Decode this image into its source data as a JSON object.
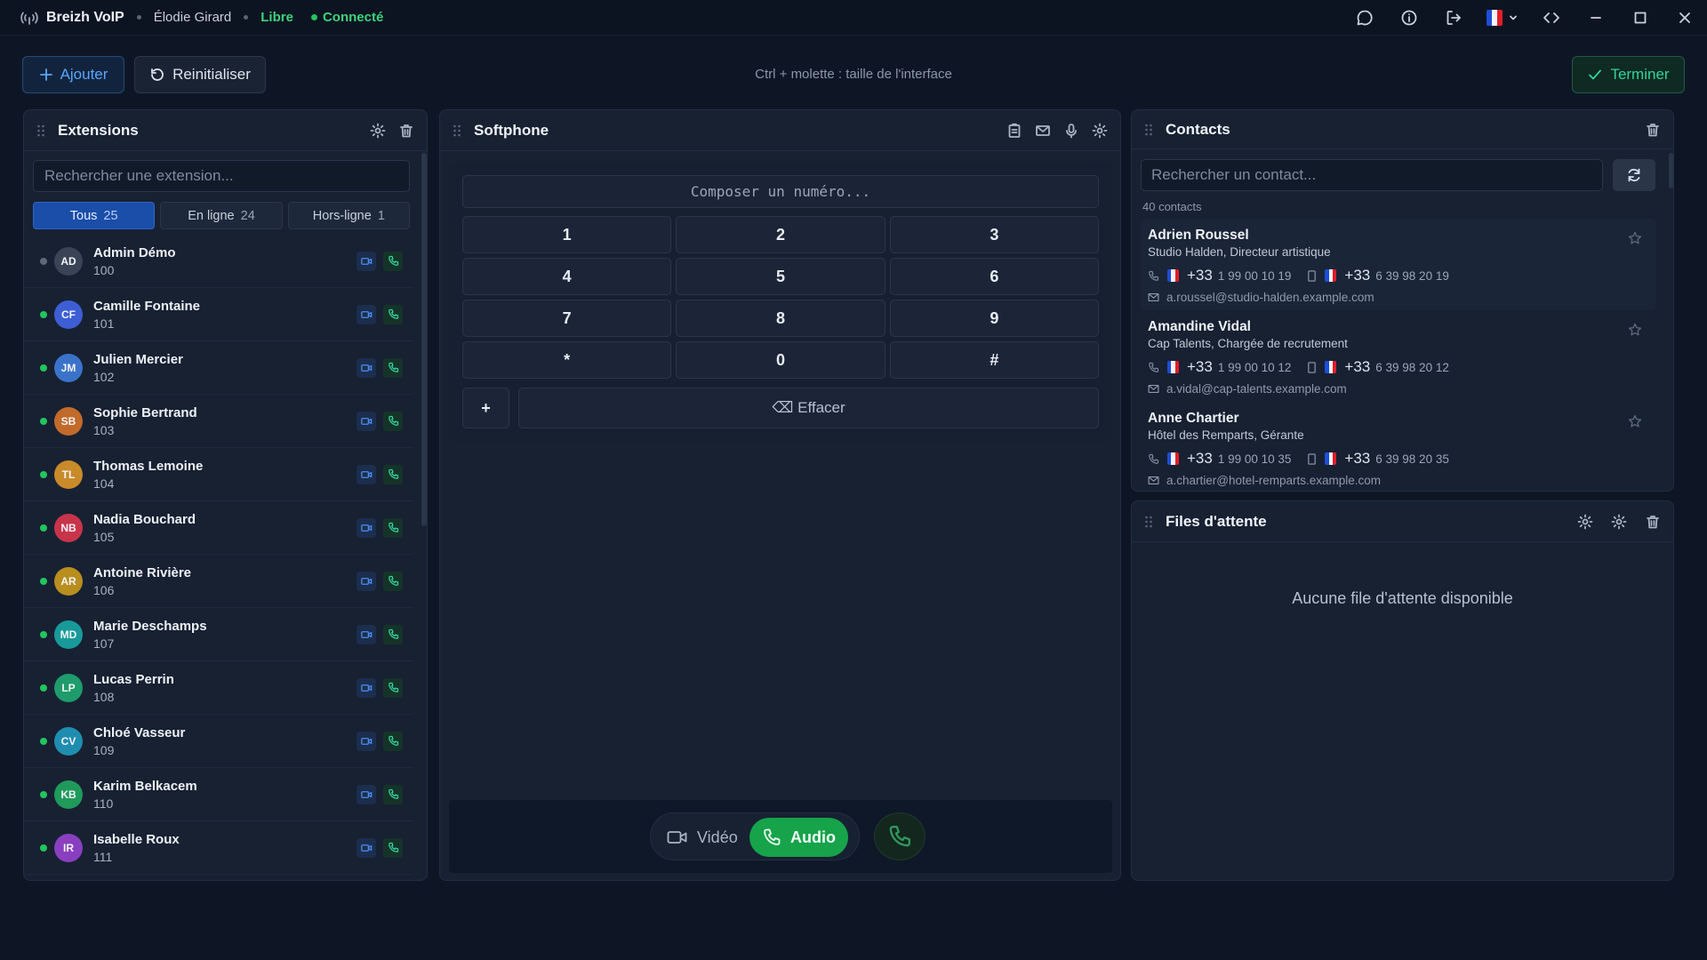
{
  "titlebar": {
    "app_name": "Breizh VoIP",
    "user": "Élodie Girard",
    "availability": "Libre",
    "connection": "Connecté"
  },
  "toolbar": {
    "add_label": "Ajouter",
    "reset_label": "Reinitialiser",
    "hint": "Ctrl + molette : taille de l'interface",
    "finish_label": "Terminer"
  },
  "extensions": {
    "title": "Extensions",
    "search_placeholder": "Rechercher une extension...",
    "filters": [
      {
        "label": "Tous",
        "count": "25"
      },
      {
        "label": "En ligne",
        "count": "24"
      },
      {
        "label": "Hors-ligne",
        "count": "1"
      }
    ],
    "items": [
      {
        "initials": "AD",
        "name": "Admin Démo",
        "ext": "100",
        "online": false,
        "color": "#3a4456"
      },
      {
        "initials": "CF",
        "name": "Camille Fontaine",
        "ext": "101",
        "online": true,
        "color": "#3d5ed4"
      },
      {
        "initials": "JM",
        "name": "Julien Mercier",
        "ext": "102",
        "online": true,
        "color": "#3a73c9"
      },
      {
        "initials": "SB",
        "name": "Sophie Bertrand",
        "ext": "103",
        "online": true,
        "color": "#c26a2a"
      },
      {
        "initials": "TL",
        "name": "Thomas Lemoine",
        "ext": "104",
        "online": true,
        "color": "#c98a2a"
      },
      {
        "initials": "NB",
        "name": "Nadia Bouchard",
        "ext": "105",
        "online": true,
        "color": "#c8344a"
      },
      {
        "initials": "AR",
        "name": "Antoine Rivière",
        "ext": "106",
        "online": true,
        "color": "#b88e1f"
      },
      {
        "initials": "MD",
        "name": "Marie Deschamps",
        "ext": "107",
        "online": true,
        "color": "#189a9a"
      },
      {
        "initials": "LP",
        "name": "Lucas Perrin",
        "ext": "108",
        "online": true,
        "color": "#1f9c6b"
      },
      {
        "initials": "CV",
        "name": "Chloé Vasseur",
        "ext": "109",
        "online": true,
        "color": "#1f8db0"
      },
      {
        "initials": "KB",
        "name": "Karim Belkacem",
        "ext": "110",
        "online": true,
        "color": "#1f9a5a"
      },
      {
        "initials": "IR",
        "name": "Isabelle Roux",
        "ext": "111",
        "online": true,
        "color": "#8a3fc0"
      }
    ]
  },
  "softphone": {
    "title": "Softphone",
    "dial_placeholder": "Composer un numéro...",
    "keys": [
      "1",
      "2",
      "3",
      "4",
      "5",
      "6",
      "7",
      "8",
      "9",
      "*",
      "0",
      "#"
    ],
    "plus_label": "+",
    "clear_label": "⌫ Effacer",
    "video_label": "Vidéo",
    "audio_label": "Audio"
  },
  "contacts": {
    "title": "Contacts",
    "search_placeholder": "Rechercher un contact...",
    "count_label": "40 contacts",
    "items": [
      {
        "name": "Adrien Roussel",
        "org": "Studio Halden, Directeur artistique",
        "cc1": "+33",
        "phone1": "1 99 00 10 19",
        "cc2": "+33",
        "phone2": "6 39 98 20 19",
        "email": "a.roussel@studio-halden.example.com"
      },
      {
        "name": "Amandine Vidal",
        "org": "Cap Talents, Chargée de recrutement",
        "cc1": "+33",
        "phone1": "1 99 00 10 12",
        "cc2": "+33",
        "phone2": "6 39 98 20 12",
        "email": "a.vidal@cap-talents.example.com"
      },
      {
        "name": "Anne Chartier",
        "org": "Hôtel des Remparts, Gérante",
        "cc1": "+33",
        "phone1": "1 99 00 10 35",
        "cc2": "+33",
        "phone2": "6 39 98 20 35",
        "email": "a.chartier@hotel-remparts.example.com"
      }
    ]
  },
  "queues": {
    "title": "Files d'attente",
    "empty_text": "Aucune file d'attente disponible"
  },
  "colors": {
    "accent_blue": "#1a4ea8",
    "online_green": "#22c55e",
    "audio_green": "#16a34a"
  },
  "icons": [
    "signal-icon",
    "chat-icon",
    "info-icon",
    "logout-icon",
    "flag-fr-icon",
    "code-icon",
    "minimize-icon",
    "maximize-icon",
    "close-icon",
    "plus-icon",
    "refresh-icon",
    "check-icon",
    "grip-icon",
    "gear-icon",
    "trash-icon",
    "clipboard-icon",
    "mail-icon",
    "mic-icon",
    "video-icon",
    "phone-icon",
    "mobile-icon",
    "star-icon"
  ]
}
